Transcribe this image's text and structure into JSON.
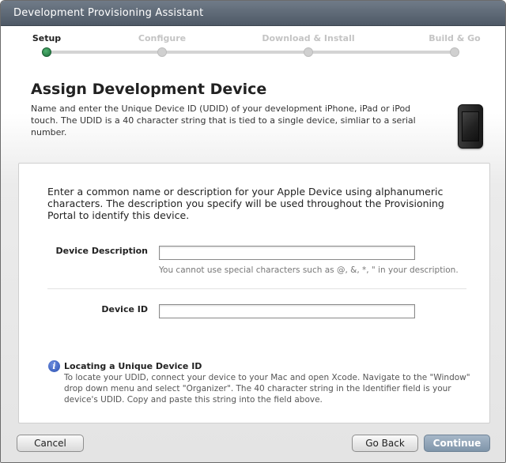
{
  "window": {
    "title": "Development Provisioning Assistant"
  },
  "steps": [
    {
      "label": "Setup",
      "active": true
    },
    {
      "label": "Configure",
      "active": false
    },
    {
      "label": "Download & Install",
      "active": false
    },
    {
      "label": "Build & Go",
      "active": false
    }
  ],
  "header": {
    "title": "Assign Development Device",
    "intro": "Name and enter the Unique Device ID (UDID) of your development iPhone, iPad or iPod touch. The UDID is a 40 character string that is tied to a single device, simliar to a serial number.",
    "device_icon": "iphone-icon"
  },
  "panel": {
    "description": "Enter a common name or description for your Apple Device using alphanumeric characters. The description you specify will be used throughout the Provisioning Portal to identify this device.",
    "fields": {
      "device_description": {
        "label": "Device Description",
        "value": "",
        "hint": "You cannot use special characters such as @, &, *, \" in your description."
      },
      "device_id": {
        "label": "Device ID",
        "value": ""
      }
    },
    "info": {
      "icon": "info-icon",
      "icon_glyph": "i",
      "title": "Locating a Unique Device ID",
      "text": "To locate your UDID, connect your device to your Mac and open Xcode. Navigate to the \"Window\" drop down menu and select \"Organizer\". The 40 character string in the Identifier field is your device's UDID. Copy and paste this string into the field above."
    }
  },
  "buttons": {
    "cancel": "Cancel",
    "go_back": "Go Back",
    "continue": "Continue"
  },
  "colors": {
    "titlebar": "#5f6a77",
    "active_step": "#2e8a4f",
    "primary_button": "#8fa3b8"
  }
}
